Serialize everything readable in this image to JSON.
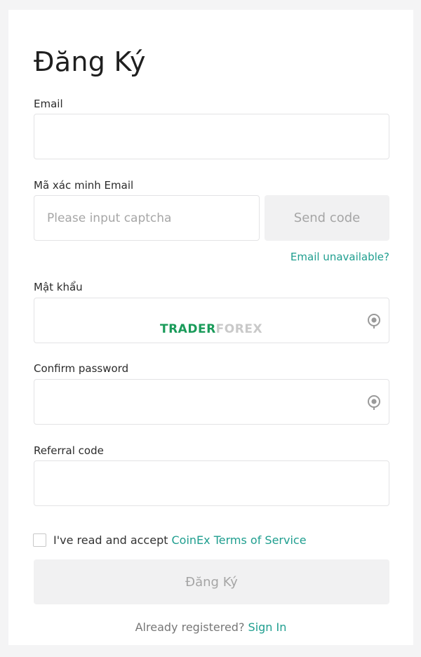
{
  "form": {
    "title": "Đăng Ký",
    "email_label": "Email",
    "email_value": "",
    "code_label": "Mã xác minh Email",
    "code_placeholder": "Please input captcha",
    "send_code_label": "Send code",
    "email_unavailable_link": "Email unavailable?",
    "password_label": "Mật khẩu",
    "confirm_label": "Confirm password",
    "referral_label": "Referral code",
    "terms_text": "I've read and accept",
    "terms_link": "CoinEx Terms of Service",
    "submit_label": "Đăng Ký",
    "already_text": "Already registered?",
    "signin_link": "Sign In"
  },
  "watermark": {
    "part_a": "TRADER",
    "part_b": "FOREX"
  },
  "colors": {
    "accent": "#1f9e8f",
    "disabled_button_bg": "#f1f1f2",
    "disabled_button_text": "#a5a5a5",
    "input_border": "#e3e3e5"
  },
  "icons": {
    "password_toggle": "eye-icon",
    "confirm_toggle": "eye-icon"
  }
}
